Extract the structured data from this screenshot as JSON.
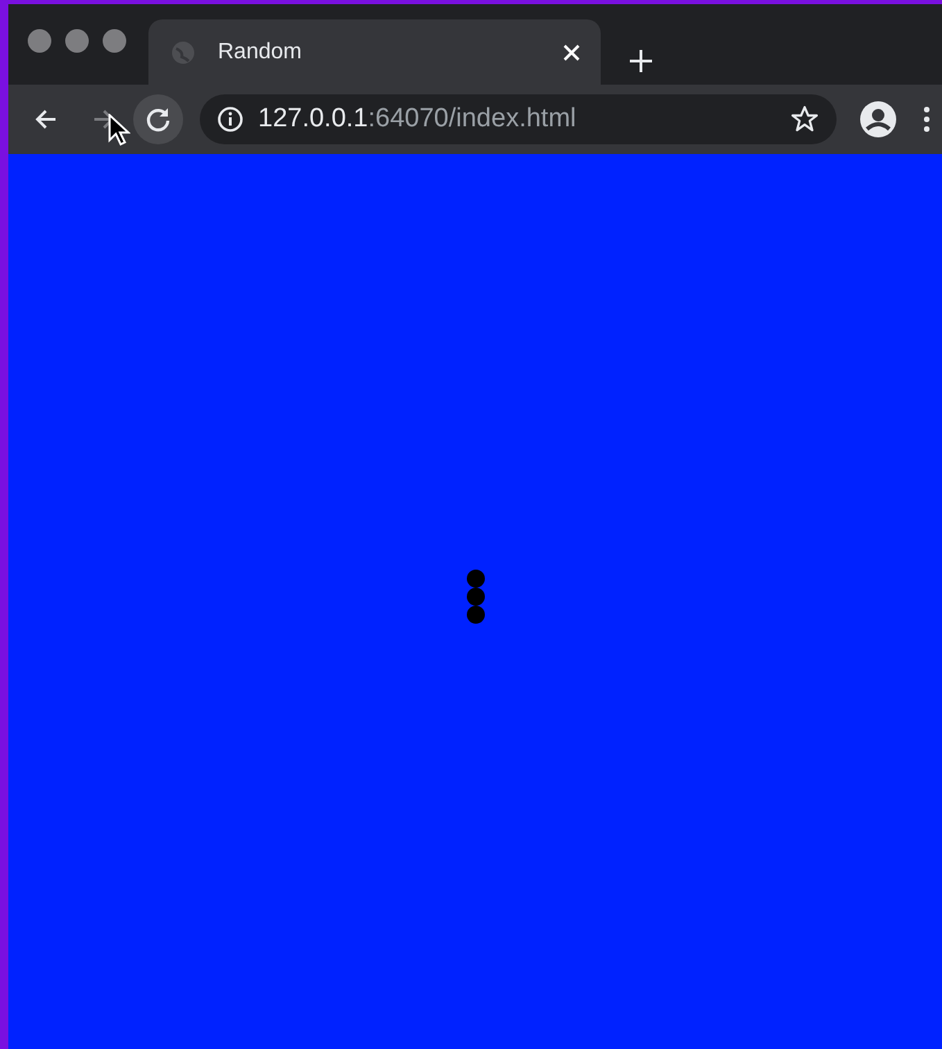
{
  "tabs": [
    {
      "title": "Random",
      "selected": true
    }
  ],
  "nav_buttons": [
    {
      "kind": "back",
      "disabled": false
    },
    {
      "kind": "forward",
      "disabled": true
    },
    {
      "kind": "reload",
      "disabled": false
    }
  ],
  "address": {
    "host": "127.0.0.1",
    "path": ":64070/index.html"
  }
}
